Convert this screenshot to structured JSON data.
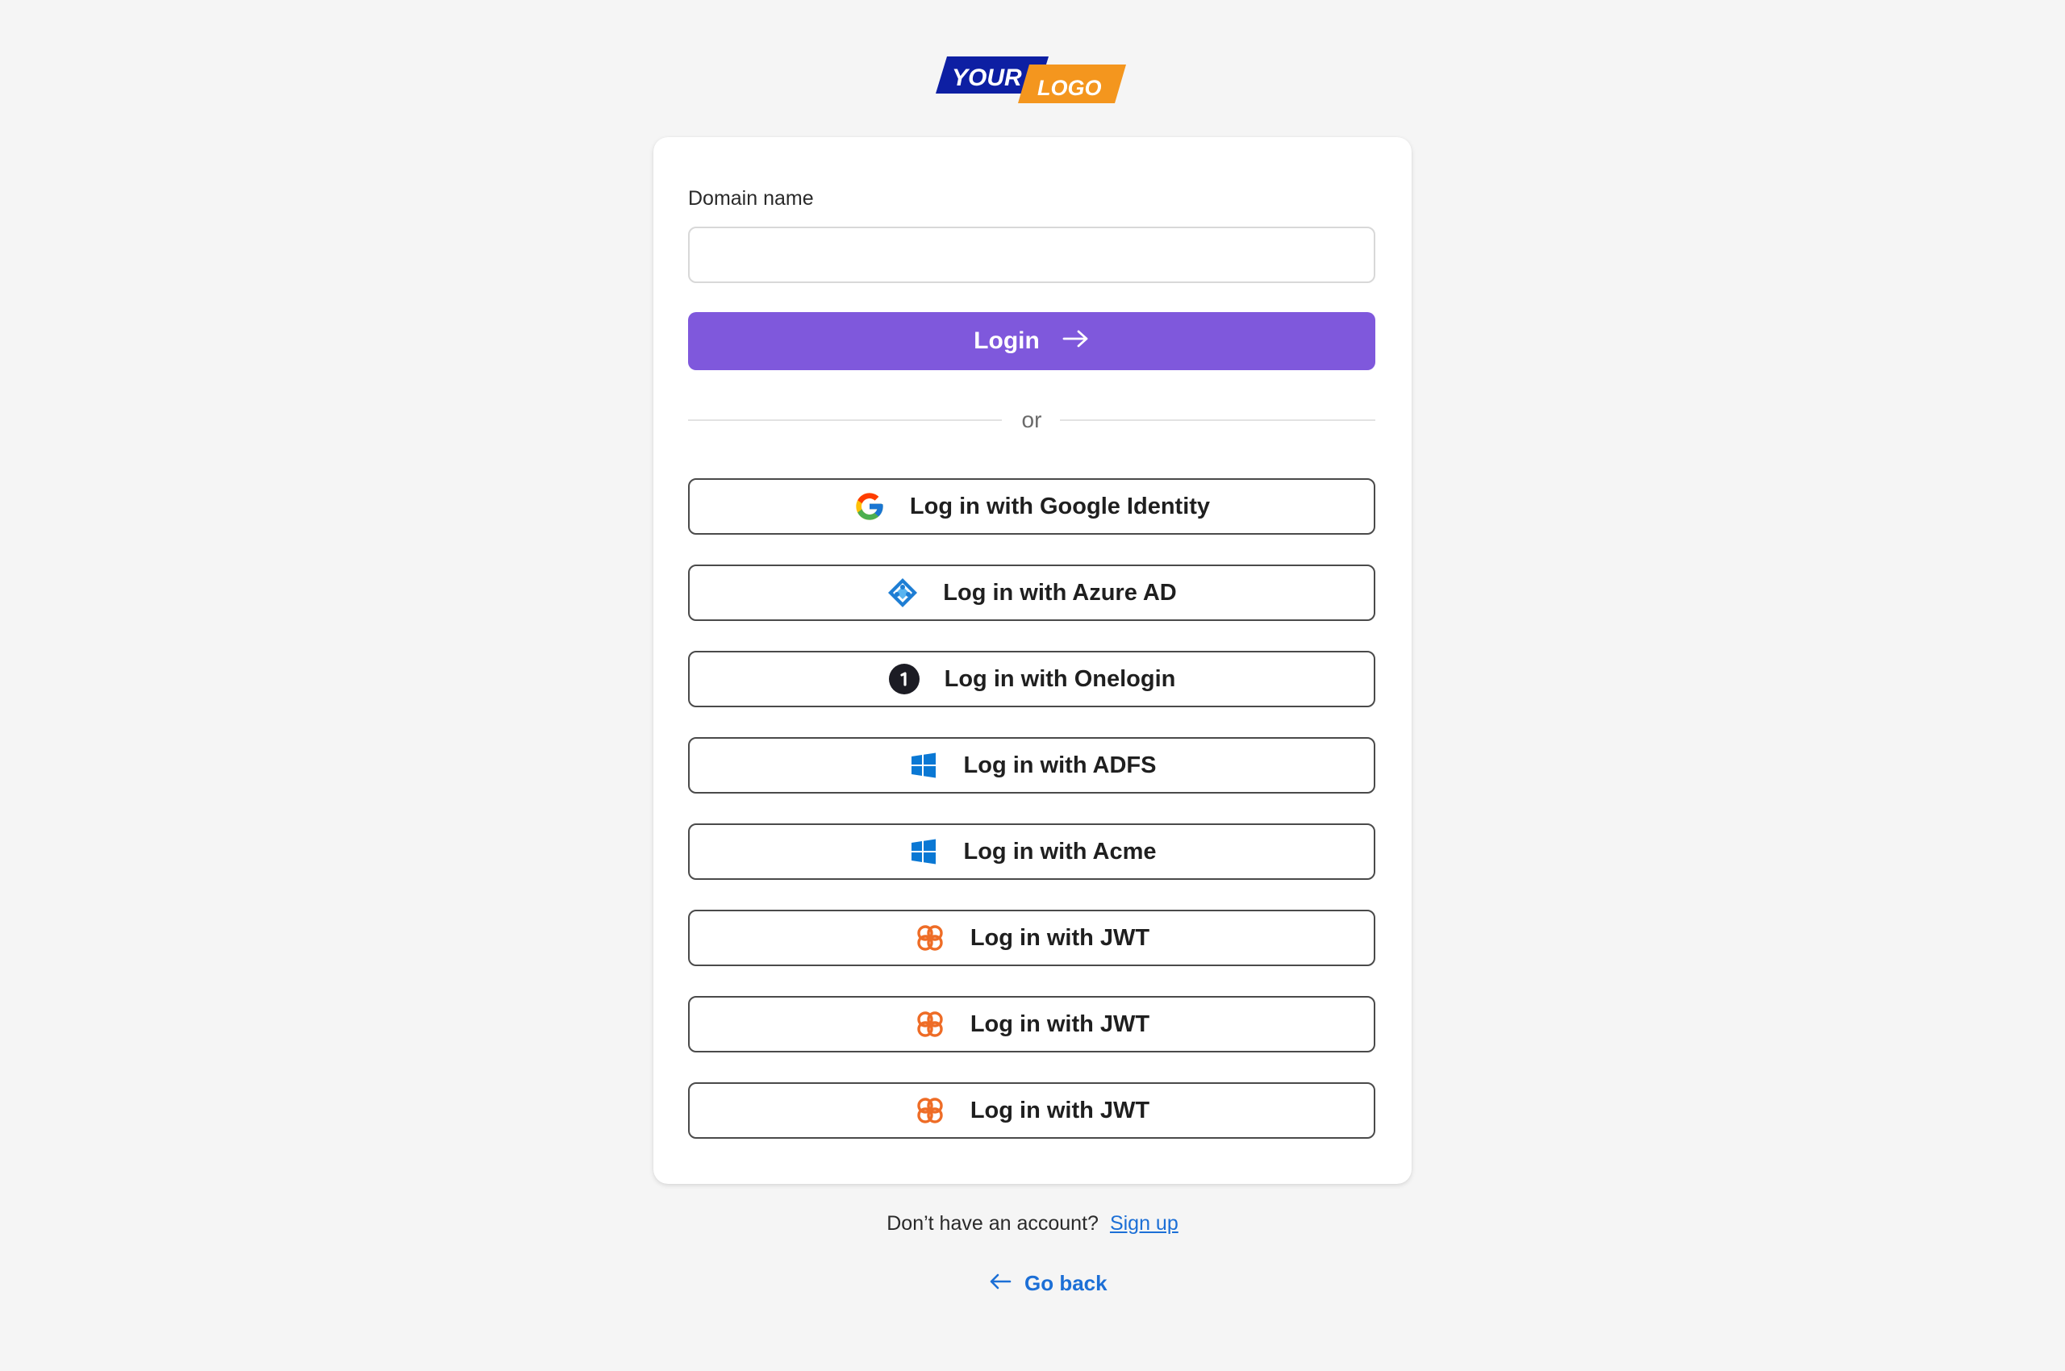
{
  "logo": {
    "text_top": "YOUR",
    "text_bottom": "LOGO",
    "color_primary": "#0d1fa3",
    "color_secondary": "#f4961e"
  },
  "form": {
    "domain_label": "Domain name",
    "domain_value": "",
    "login_label": "Login",
    "login_icon": "arrow-right-icon",
    "accent_color": "#7f58dc",
    "divider_text": "or"
  },
  "providers": [
    {
      "label": "Log in with Google Identity",
      "icon": "google-icon"
    },
    {
      "label": "Log in with Azure AD",
      "icon": "azure-ad-icon"
    },
    {
      "label": "Log in with Onelogin",
      "icon": "onelogin-icon"
    },
    {
      "label": "Log in with ADFS",
      "icon": "windows-icon"
    },
    {
      "label": "Log in with Acme",
      "icon": "windows-icon"
    },
    {
      "label": "Log in with JWT",
      "icon": "jwt-icon"
    },
    {
      "label": "Log in with JWT",
      "icon": "jwt-icon"
    },
    {
      "label": "Log in with JWT",
      "icon": "jwt-icon"
    }
  ],
  "footer": {
    "prompt": "Don’t have an account?",
    "signup_label": "Sign up",
    "go_back_label": "Go back",
    "go_back_icon": "arrow-left-icon",
    "link_color": "#1c6fd6"
  }
}
